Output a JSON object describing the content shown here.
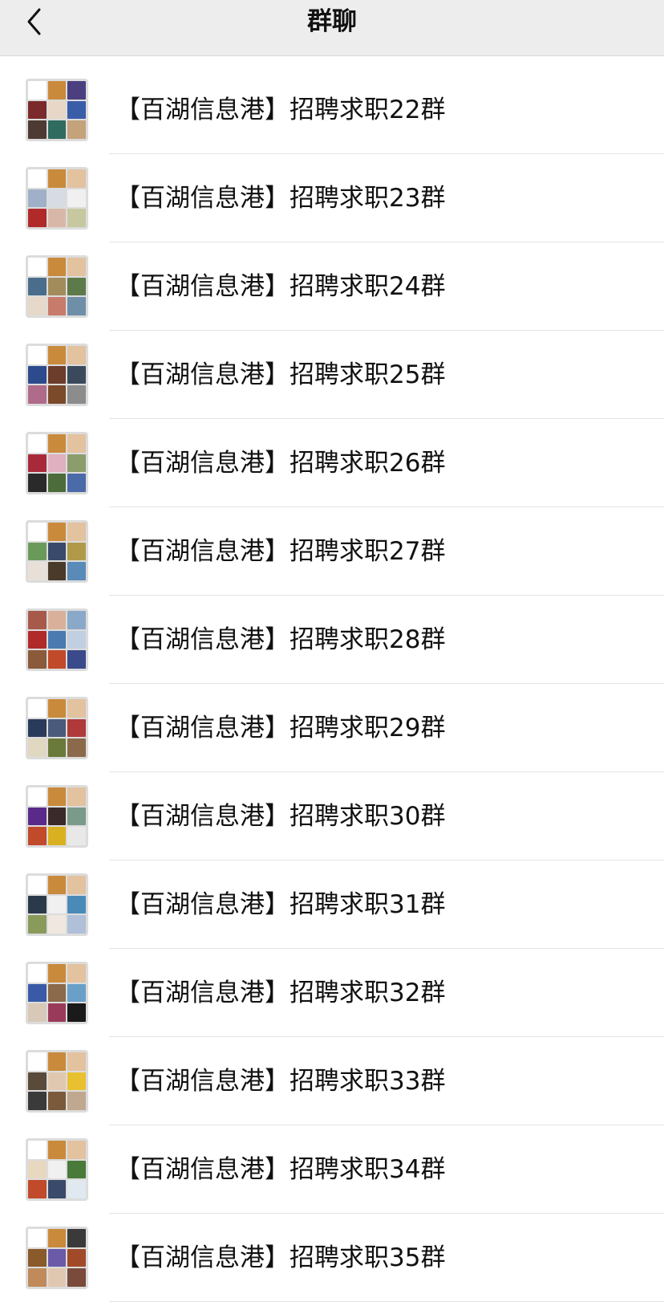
{
  "header": {
    "title": "群聊",
    "back_icon": "chevron-left-icon"
  },
  "groups": [
    {
      "name": "【百湖信息港】招聘求职22群",
      "avatar_colors": [
        "#ffffff",
        "#c98a3c",
        "#4b3f80",
        "#7a2a2a",
        "#e8d7c6",
        "#3a5da8",
        "#4d3a33",
        "#2f6b5e",
        "#c4a27a"
      ]
    },
    {
      "name": "【百湖信息港】招聘求职23群",
      "avatar_colors": [
        "#ffffff",
        "#c98a3c",
        "#e2c29f",
        "#9fb0c8",
        "#d7dbe4",
        "#f0f0f0",
        "#b02a2a",
        "#d9b7a8",
        "#c8c8a0"
      ]
    },
    {
      "name": "【百湖信息港】招聘求职24群",
      "avatar_colors": [
        "#ffffff",
        "#c98a3c",
        "#e2c29f",
        "#4a6d8c",
        "#a38c5c",
        "#5c7a4a",
        "#e6d9c9",
        "#c77b6b",
        "#6f8fa8"
      ]
    },
    {
      "name": "【百湖信息港】招聘求职25群",
      "avatar_colors": [
        "#ffffff",
        "#c98a3c",
        "#e2c29f",
        "#2c4a8c",
        "#6b3d2a",
        "#3a4a5c",
        "#b06a8a",
        "#7a4a2a",
        "#8c8c8c"
      ]
    },
    {
      "name": "【百湖信息港】招聘求职26群",
      "avatar_colors": [
        "#ffffff",
        "#c98a3c",
        "#e2c29f",
        "#a82a3a",
        "#e0b0c0",
        "#8c9c6c",
        "#2a2a2a",
        "#4c6c3c",
        "#4a6aa8"
      ]
    },
    {
      "name": "【百湖信息港】招聘求职27群",
      "avatar_colors": [
        "#ffffff",
        "#c98a3c",
        "#e2c29f",
        "#6a9a5a",
        "#3a4a6a",
        "#b09a4a",
        "#e8e0d8",
        "#4a3a2a",
        "#5a8ab8"
      ]
    },
    {
      "name": "【百湖信息港】招聘求职28群",
      "avatar_colors": [
        "#a85a4a",
        "#d9b09a",
        "#8aa8c8",
        "#b02a2a",
        "#4a7ab0",
        "#c0d0e0",
        "#8a5a3a",
        "#c04a2a",
        "#3a4a8a"
      ]
    },
    {
      "name": "【百湖信息港】招聘求职29群",
      "avatar_colors": [
        "#ffffff",
        "#c98a3c",
        "#e2c29f",
        "#2a3a5a",
        "#4a5a7a",
        "#b03a3a",
        "#e0d8c0",
        "#6a7a3a",
        "#8a6a4a"
      ]
    },
    {
      "name": "【百湖信息港】招聘求职30群",
      "avatar_colors": [
        "#ffffff",
        "#c98a3c",
        "#e2c29f",
        "#5a2a8a",
        "#3a2a2a",
        "#7a9a8a",
        "#c04a2a",
        "#d9b020",
        "#e8e8e8"
      ]
    },
    {
      "name": "【百湖信息港】招聘求职31群",
      "avatar_colors": [
        "#ffffff",
        "#c98a3c",
        "#e2c29f",
        "#2a3a4a",
        "#f0f0f0",
        "#4a8ab8",
        "#8a9a5a",
        "#f0e8e0",
        "#b0c0d8"
      ]
    },
    {
      "name": "【百湖信息港】招聘求职32群",
      "avatar_colors": [
        "#ffffff",
        "#c98a3c",
        "#e2c29f",
        "#3a5aa8",
        "#8a6a4a",
        "#6aa0c8",
        "#d8c8b8",
        "#9a3a5a",
        "#1a1a1a"
      ]
    },
    {
      "name": "【百湖信息港】招聘求职33群",
      "avatar_colors": [
        "#ffffff",
        "#c98a3c",
        "#e2c29f",
        "#5a4a3a",
        "#e0c8b0",
        "#e8c030",
        "#3a3a3a",
        "#7a5a3a",
        "#c0a890"
      ]
    },
    {
      "name": "【百湖信息港】招聘求职34群",
      "avatar_colors": [
        "#ffffff",
        "#c98a3c",
        "#e2c29f",
        "#e8d8c0",
        "#f0f0f0",
        "#4a7a3a",
        "#c04a2a",
        "#3a4a6a",
        "#e0e8f0"
      ]
    },
    {
      "name": "【百湖信息港】招聘求职35群",
      "avatar_colors": [
        "#ffffff",
        "#c98a3c",
        "#3a3a3a",
        "#8a5a2a",
        "#6a5aa8",
        "#a04a2a",
        "#c08a5a",
        "#e0c8b0",
        "#7a4a3a"
      ]
    }
  ]
}
